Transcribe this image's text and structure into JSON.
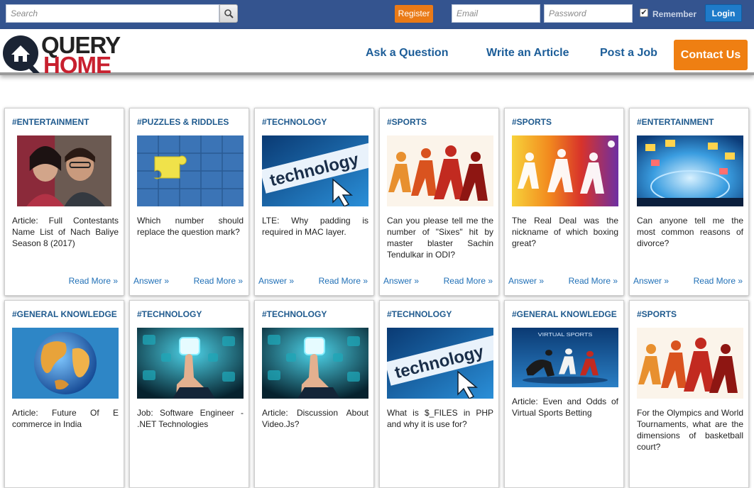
{
  "topbar": {
    "search_placeholder": "Search",
    "register_label": "Register",
    "email_placeholder": "Email",
    "password_placeholder": "Password",
    "remember_checked": true,
    "remember_label": "Remember",
    "login_label": "Login"
  },
  "header": {
    "logo_line1": "QUERY",
    "logo_line2": "HOME",
    "nav": [
      "Ask a Question",
      "Write an Article",
      "Post a Job"
    ],
    "contact_label": "Contact Us"
  },
  "labels": {
    "answer": "Answer »",
    "read_more": "Read More »"
  },
  "cards": [
    {
      "tag": "#ENTERTAINMENT",
      "title": "Article: Full Contestants Name List of Nach Baliye Season 8 (2017)",
      "has_answer": false,
      "image": "couple-photo"
    },
    {
      "tag": "#PUZZLES & RIDDLES",
      "title": "Which number should replace the question mark?",
      "has_answer": true,
      "image": "puzzle-pieces"
    },
    {
      "tag": "#TECHNOLOGY",
      "title": "LTE: Why padding is required in MAC layer.",
      "has_answer": true,
      "image": "technology-cursor"
    },
    {
      "tag": "#SPORTS",
      "title": "Can you please tell me the number of \"Sixes\" hit by master blaster Sachin Tendulkar in ODI?",
      "has_answer": true,
      "image": "sports-silhouettes"
    },
    {
      "tag": "#SPORTS",
      "title": "The Real Deal was the nickname of which boxing great?",
      "has_answer": true,
      "image": "sports-rainbow"
    },
    {
      "tag": "#ENTERTAINMENT",
      "title": "Can anyone tell me the most common reasons of divorce?",
      "has_answer": true,
      "image": "media-globe"
    },
    {
      "tag": "#GENERAL KNOWLEDGE",
      "title": "Article: Future Of E commerce in India",
      "has_answer": false,
      "image": "earth-globe"
    },
    {
      "tag": "#TECHNOLOGY",
      "title": "Job: Software Engineer - .NET Technologies",
      "has_answer": false,
      "image": "touch-screen"
    },
    {
      "tag": "#TECHNOLOGY",
      "title": "Article: Discussion About Video.Js?",
      "has_answer": false,
      "image": "touch-screen"
    },
    {
      "tag": "#TECHNOLOGY",
      "title": "What is $_FILES in PHP and why it is use for?",
      "has_answer": false,
      "image": "technology-cursor"
    },
    {
      "tag": "#GENERAL KNOWLEDGE",
      "title": "Article: Even and Odds of Virtual Sports Betting",
      "has_answer": false,
      "image": "virtual-sports"
    },
    {
      "tag": "#SPORTS",
      "title": "For the Olympics and World Tournaments, what are the dimensions of basketball court?",
      "has_answer": false,
      "image": "sports-silhouettes"
    }
  ],
  "virtual_sports_caption": "VIRTUAL SPORTS"
}
